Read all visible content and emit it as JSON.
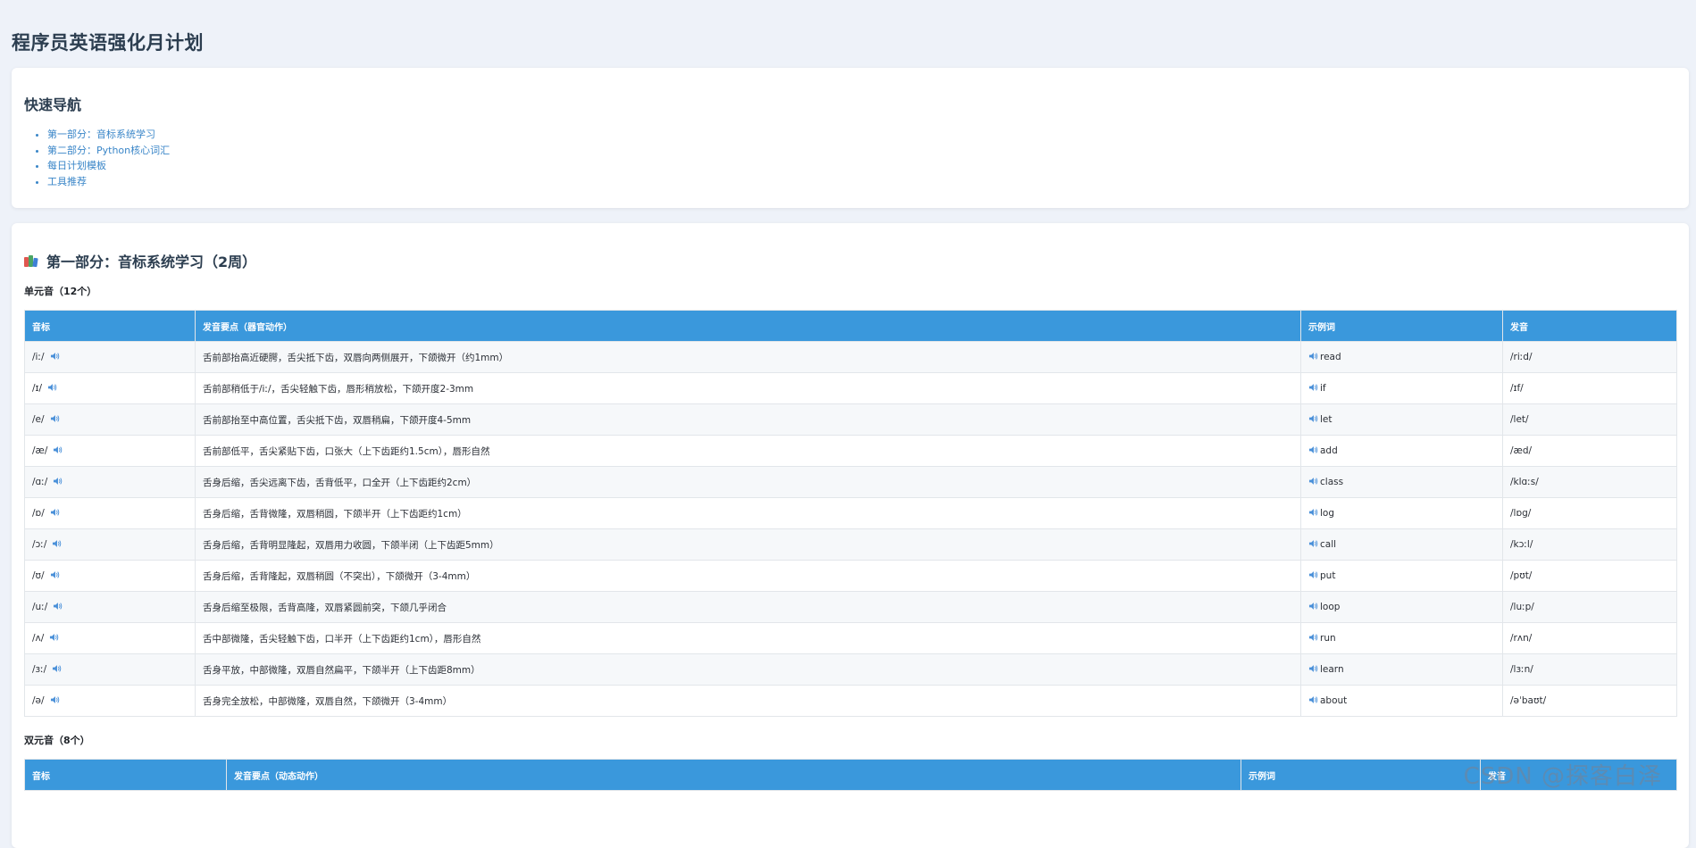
{
  "page": {
    "title": "程序员英语强化月计划"
  },
  "nav": {
    "heading": "快速导航",
    "items": [
      "第一部分：音标系统学习",
      "第二部分：Python核心词汇",
      "每日计划模板",
      "工具推荐"
    ]
  },
  "section1": {
    "title": "第一部分：音标系统学习（2周）",
    "icon": "books-icon",
    "monophthongs": {
      "title": "单元音（12个）",
      "headers": [
        "音标",
        "发音要点（器官动作）",
        "示例词",
        "发音"
      ],
      "rows": [
        {
          "symbol": "/iː/",
          "desc": "舌前部抬高近硬腭，舌尖抵下齿，双唇向两侧展开，下颌微开（约1mm）",
          "word": "read",
          "pron": "/riːd/"
        },
        {
          "symbol": "/ɪ/",
          "desc": "舌前部稍低于/iː/，舌尖轻触下齿，唇形稍放松，下颌开度2-3mm",
          "word": "if",
          "pron": "/ɪf/"
        },
        {
          "symbol": "/e/",
          "desc": "舌前部抬至中高位置，舌尖抵下齿，双唇稍扁，下颌开度4-5mm",
          "word": "let",
          "pron": "/let/"
        },
        {
          "symbol": "/æ/",
          "desc": "舌前部低平，舌尖紧贴下齿，口张大（上下齿距约1.5cm），唇形自然",
          "word": "add",
          "pron": "/æd/"
        },
        {
          "symbol": "/ɑː/",
          "desc": "舌身后缩，舌尖远离下齿，舌背低平，口全开（上下齿距约2cm）",
          "word": "class",
          "pron": "/klɑːs/"
        },
        {
          "symbol": "/ɒ/",
          "desc": "舌身后缩，舌背微隆，双唇稍圆，下颌半开（上下齿距约1cm）",
          "word": "log",
          "pron": "/lɒg/"
        },
        {
          "symbol": "/ɔː/",
          "desc": "舌身后缩，舌背明显隆起，双唇用力收圆，下颌半闭（上下齿距5mm）",
          "word": "call",
          "pron": "/kɔːl/"
        },
        {
          "symbol": "/ʊ/",
          "desc": "舌身后缩，舌背隆起，双唇稍圆（不突出），下颌微开（3-4mm）",
          "word": "put",
          "pron": "/pʊt/"
        },
        {
          "symbol": "/uː/",
          "desc": "舌身后缩至极限，舌背高隆，双唇紧圆前突，下颌几乎闭合",
          "word": "loop",
          "pron": "/luːp/"
        },
        {
          "symbol": "/ʌ/",
          "desc": "舌中部微隆，舌尖轻触下齿，口半开（上下齿距约1cm），唇形自然",
          "word": "run",
          "pron": "/rʌn/"
        },
        {
          "symbol": "/ɜː/",
          "desc": "舌身平放，中部微隆，双唇自然扁平，下颌半开（上下齿距8mm）",
          "word": "learn",
          "pron": "/lɜːn/"
        },
        {
          "symbol": "/ə/",
          "desc": "舌身完全放松，中部微隆，双唇自然，下颌微开（3-4mm）",
          "word": "about",
          "pron": "/əˈbaʊt/"
        }
      ]
    },
    "diphthongs": {
      "title": "双元音（8个）",
      "headers": [
        "音标",
        "发音要点（动态动作）",
        "示例词",
        "发音"
      ]
    }
  },
  "colors": {
    "accent": "#3a98dc",
    "link": "#3a86c8",
    "background": "#eef2f9"
  },
  "watermark": "CSDN @探客白泽"
}
